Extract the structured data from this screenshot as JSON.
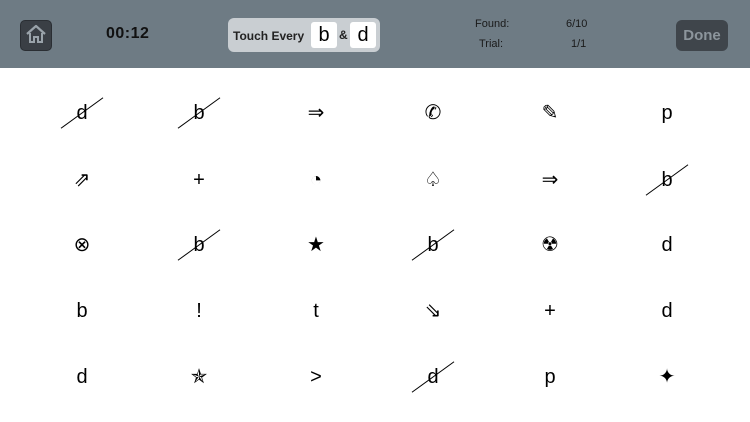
{
  "header": {
    "home_icon": "house-icon",
    "timer": "00:12",
    "instruction": {
      "label": "Touch Every",
      "letter1": "b",
      "amp": "&",
      "letter2": "d"
    },
    "stats": {
      "found_label": "Found:",
      "found_value": "6/10",
      "trial_label": "Trial:",
      "trial_value": "1/1"
    },
    "done_label": "Done"
  },
  "colors": {
    "topbar": "#6e7b84",
    "button_dark": "#3f454b",
    "instruction_bg": "#c9ced2"
  },
  "grid": {
    "rows": [
      [
        {
          "symbol": "d",
          "found": true
        },
        {
          "symbol": "b",
          "found": true
        },
        {
          "symbol": "⇒",
          "found": false
        },
        {
          "symbol": "✆",
          "found": false
        },
        {
          "symbol": "✎",
          "found": false
        },
        {
          "symbol": "p",
          "found": false
        }
      ],
      [
        {
          "symbol": "⇗",
          "found": false
        },
        {
          "symbol": "+",
          "found": false
        },
        {
          "symbol": "◔",
          "found": false
        },
        {
          "symbol": "♤",
          "found": false
        },
        {
          "symbol": "⇒",
          "found": false
        },
        {
          "symbol": "b",
          "found": true
        }
      ],
      [
        {
          "symbol": "⊗",
          "found": false
        },
        {
          "symbol": "b",
          "found": true
        },
        {
          "symbol": "★",
          "found": false
        },
        {
          "symbol": "b",
          "found": true
        },
        {
          "symbol": "☢",
          "found": false
        },
        {
          "symbol": "d",
          "found": false
        }
      ],
      [
        {
          "symbol": "b",
          "found": false
        },
        {
          "symbol": "!",
          "found": false
        },
        {
          "symbol": "t",
          "found": false
        },
        {
          "symbol": "⇘",
          "found": false
        },
        {
          "symbol": "+",
          "found": false
        },
        {
          "symbol": "d",
          "found": false
        }
      ],
      [
        {
          "symbol": "d",
          "found": false
        },
        {
          "symbol": "✯",
          "found": false
        },
        {
          "symbol": ">",
          "found": false
        },
        {
          "symbol": "d",
          "found": true
        },
        {
          "symbol": "p",
          "found": false
        },
        {
          "symbol": "✦",
          "found": false
        }
      ]
    ]
  }
}
